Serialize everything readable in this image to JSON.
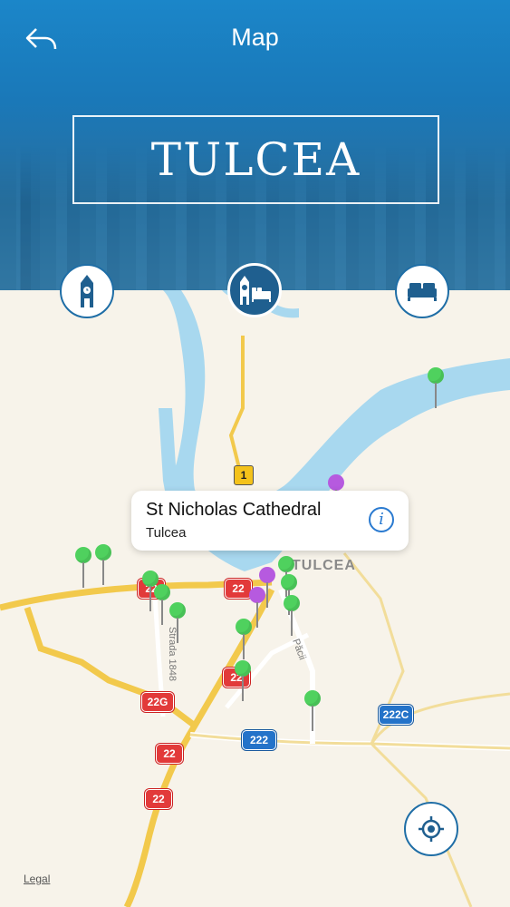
{
  "header": {
    "title": "Map",
    "banner_text": "TULCEA",
    "back_icon": "back-arrow-icon"
  },
  "categories": [
    {
      "id": "sights",
      "icon": "clock-tower-icon",
      "selected": false
    },
    {
      "id": "all",
      "icon": "tower-and-bed-icon",
      "selected": true
    },
    {
      "id": "hotels",
      "icon": "bed-icon",
      "selected": false
    }
  ],
  "callout": {
    "title": "St Nicholas Cathedral",
    "subtitle": "Tulcea",
    "info_icon": "info-icon"
  },
  "map": {
    "city_label": "TULCEA",
    "streets": [
      "Strada 1848",
      "Păcii"
    ],
    "road_shields": [
      "1",
      "22",
      "22",
      "22",
      "22",
      "22G",
      "22",
      "22",
      "222",
      "222C"
    ],
    "legal_link": "Legal",
    "locate_icon": "locate-me-icon"
  },
  "colors": {
    "header_blue": "#1b86c9",
    "water": "#a8d8ef",
    "land": "#f7f3ea",
    "road_yellow": "#f2c94c",
    "pin_green": "#4fd15e",
    "pin_purple": "#b65adf"
  }
}
